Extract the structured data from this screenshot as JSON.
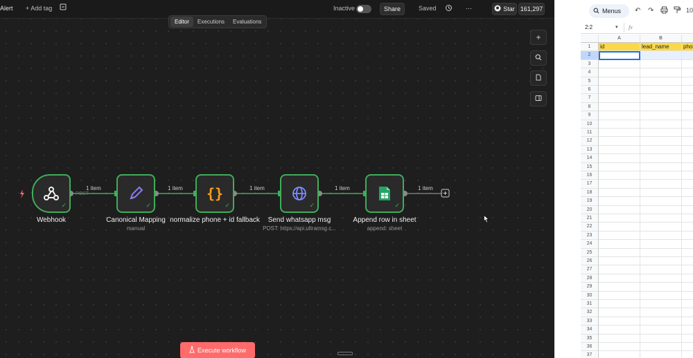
{
  "n8n": {
    "workflow_name": "Alert",
    "add_tag": "+ Add tag",
    "status_label": "Inactive",
    "share_label": "Share",
    "saved_label": "Saved",
    "more_label": "···",
    "star_label": "Star",
    "star_count": "161,297",
    "tabs": [
      {
        "label": "Editor",
        "active": true
      },
      {
        "label": "Executions",
        "active": false
      },
      {
        "label": "Evaluations",
        "active": false
      }
    ],
    "nodes": [
      {
        "title": "Webhook",
        "subtitle": ""
      },
      {
        "title": "Canonical Mapping",
        "subtitle": "manual"
      },
      {
        "title": "normalize phone + id fallback",
        "subtitle": ""
      },
      {
        "title": "Send whatsapp msg",
        "subtitle": "POST: https://api.ultramsg.c..."
      },
      {
        "title": "Append row in sheet",
        "subtitle": "append: sheet"
      }
    ],
    "edge_labels": [
      "1 item",
      "1 item",
      "1 item",
      "1 item",
      "1 item"
    ],
    "webhook_method": "POST",
    "execute_label": "Execute workflow",
    "colors": {
      "success": "#3fae5a",
      "execute": "#ff6b6b",
      "canvas": "#1e1e1e"
    }
  },
  "sheet": {
    "menus_label": "Menus",
    "zoom_partial": "10",
    "cell_ref": "2:2",
    "fx_label": "fx",
    "columns": [
      "A",
      "B"
    ],
    "header_row": [
      "id",
      "lead_name",
      "phon"
    ],
    "row_numbers": [
      "1",
      "2",
      "3",
      "4",
      "5",
      "6",
      "7",
      "8",
      "9",
      "10",
      "11",
      "12",
      "13",
      "14",
      "15",
      "16",
      "17",
      "18",
      "19",
      "20",
      "21",
      "22",
      "23",
      "24",
      "25",
      "26",
      "27",
      "28",
      "29",
      "30",
      "31",
      "32",
      "33",
      "34",
      "35",
      "36",
      "37"
    ]
  }
}
